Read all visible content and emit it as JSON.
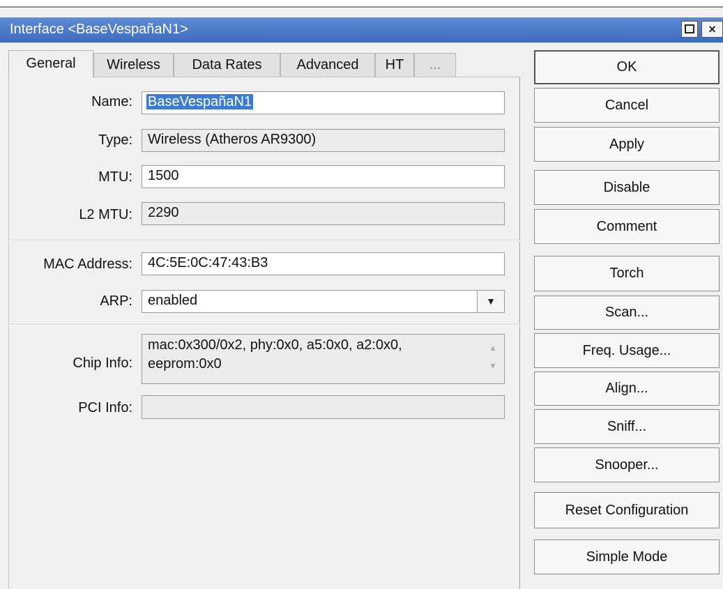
{
  "window": {
    "title": "Interface <BaseVespañaN1>",
    "maximize_icon": "maximize-icon",
    "close_icon": "close-icon",
    "close_glyph": "×"
  },
  "tabs": [
    "General",
    "Wireless",
    "Data Rates",
    "Advanced",
    "HT",
    "..."
  ],
  "active_tab": "General",
  "form": {
    "name_label": "Name:",
    "name_value": "BaseVespañaN1",
    "type_label": "Type:",
    "type_value": "Wireless (Atheros AR9300)",
    "mtu_label": "MTU:",
    "mtu_value": "1500",
    "l2mtu_label": "L2 MTU:",
    "l2mtu_value": "2290",
    "mac_label": "MAC Address:",
    "mac_value": "4C:5E:0C:47:43:B3",
    "arp_label": "ARP:",
    "arp_value": "enabled",
    "chip_label": "Chip Info:",
    "chip_value": "mac:0x300/0x2, phy:0x0, a5:0x0, a2:0x0, eeprom:0x0",
    "pci_label": "PCI Info:",
    "pci_value": ""
  },
  "buttons": {
    "ok": "OK",
    "cancel": "Cancel",
    "apply": "Apply",
    "disable": "Disable",
    "comment": "Comment",
    "torch": "Torch",
    "scan": "Scan...",
    "freq_usage": "Freq. Usage...",
    "align": "Align...",
    "sniff": "Sniff...",
    "snooper": "Snooper...",
    "reset_configuration": "Reset Configuration",
    "simple_mode": "Simple Mode"
  },
  "colors": {
    "titlebar": "#4a78c8",
    "selection": "#3b7bd4",
    "background": "#f0f0f0"
  }
}
